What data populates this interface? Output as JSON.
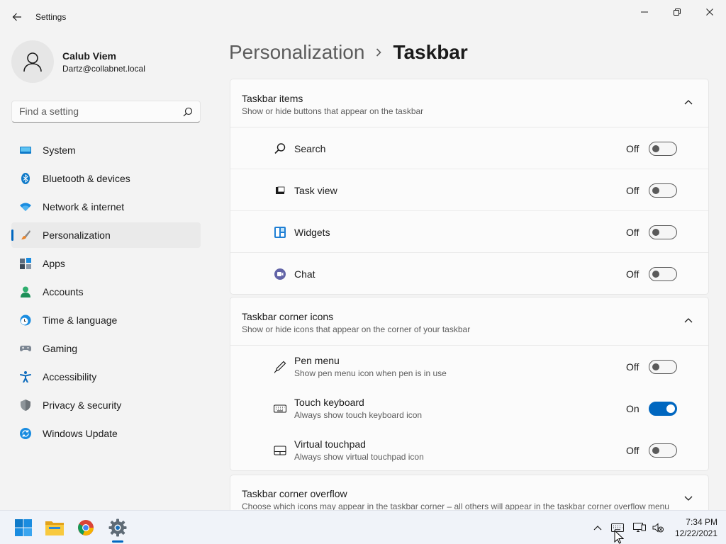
{
  "window": {
    "title": "Settings"
  },
  "profile": {
    "name": "Calub Viem",
    "email": "Dartz@collabnet.local"
  },
  "search": {
    "placeholder": "Find a setting"
  },
  "nav": [
    {
      "label": "System",
      "icon": "monitor-icon"
    },
    {
      "label": "Bluetooth & devices",
      "icon": "bluetooth-icon"
    },
    {
      "label": "Network & internet",
      "icon": "wifi-icon"
    },
    {
      "label": "Personalization",
      "icon": "paintbrush-icon",
      "active": true
    },
    {
      "label": "Apps",
      "icon": "apps-icon"
    },
    {
      "label": "Accounts",
      "icon": "person-icon"
    },
    {
      "label": "Time & language",
      "icon": "clock-globe-icon"
    },
    {
      "label": "Gaming",
      "icon": "gamepad-icon"
    },
    {
      "label": "Accessibility",
      "icon": "accessibility-icon"
    },
    {
      "label": "Privacy & security",
      "icon": "shield-icon"
    },
    {
      "label": "Windows Update",
      "icon": "update-icon"
    }
  ],
  "breadcrumb": {
    "parent": "Personalization",
    "current": "Taskbar"
  },
  "sections": {
    "items": {
      "title": "Taskbar items",
      "subtitle": "Show or hide buttons that appear on the taskbar",
      "rows": [
        {
          "label": "Search",
          "state": "Off",
          "icon": "search-icon"
        },
        {
          "label": "Task view",
          "state": "Off",
          "icon": "task-view-icon"
        },
        {
          "label": "Widgets",
          "state": "Off",
          "icon": "widgets-icon"
        },
        {
          "label": "Chat",
          "state": "Off",
          "icon": "chat-icon"
        }
      ]
    },
    "corner": {
      "title": "Taskbar corner icons",
      "subtitle": "Show or hide icons that appear on the corner of your taskbar",
      "rows": [
        {
          "label": "Pen menu",
          "sub": "Show pen menu icon when pen is in use",
          "state": "Off",
          "icon": "pen-icon"
        },
        {
          "label": "Touch keyboard",
          "sub": "Always show touch keyboard icon",
          "state": "On",
          "icon": "keyboard-icon"
        },
        {
          "label": "Virtual touchpad",
          "sub": "Always show virtual touchpad icon",
          "state": "Off",
          "icon": "touchpad-icon"
        }
      ]
    },
    "overflow": {
      "title": "Taskbar corner overflow",
      "subtitle": "Choose which icons may appear in the taskbar corner – all others will appear in the taskbar corner overflow menu"
    }
  },
  "taskbar": {
    "apps": [
      "windows-start-icon",
      "file-explorer-icon",
      "chrome-icon",
      "settings-icon"
    ],
    "time": "7:34 PM",
    "date": "12/22/2021"
  },
  "colors": {
    "accent": "#0067c0",
    "background": "#f3f3f3",
    "card": "#fbfbfb"
  }
}
